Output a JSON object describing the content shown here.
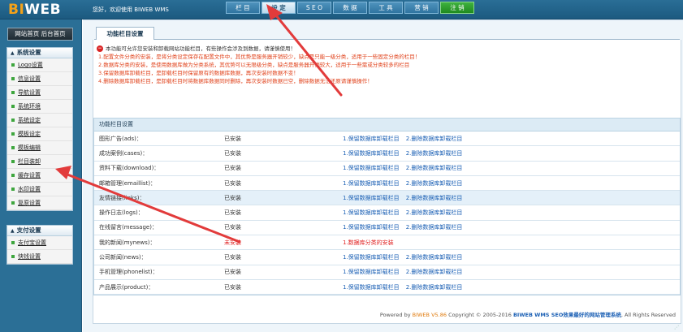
{
  "header": {
    "logo_bi": "BI",
    "logo_web": "WEB",
    "welcome": "您好，欢迎使用 BIWEB WMS",
    "nav": [
      {
        "label": "栏 目",
        "active": false
      },
      {
        "label": "设 定",
        "active": true
      },
      {
        "label": "S E O",
        "active": false
      },
      {
        "label": "数 据",
        "active": false
      },
      {
        "label": "工 具",
        "active": false
      },
      {
        "label": "营 销",
        "active": false
      },
      {
        "label": "注 销",
        "active": false
      }
    ]
  },
  "sidebar": {
    "home_button": "网站首页 后台首页",
    "system": {
      "title": "系统设置",
      "items": [
        "Logo设置",
        "信息设置",
        "导航设置",
        "系统环境",
        "系统设定",
        "模板设定",
        "模板编辑",
        "栏目装卸",
        "缓存设置",
        "水印设置",
        "复原设置"
      ]
    },
    "payment": {
      "title": "支付设置",
      "items": [
        "支付宝设置",
        "快钱设置"
      ]
    }
  },
  "main": {
    "tab": "功能栏目设置",
    "warnings": [
      "本功能可允许您安装和卸载网站功能栏目，有些操作会涉及到数据，请谨慎使用！",
      "1.配置文件分类的安装，是将分类设定保存在配置文件中，其优势是服务器开销较少，缺点是只能一级分类，适用于一些固定分类的栏目！",
      "2.数据库分类的安装，是使用数据库做为分类系统，其优势可以无限级分类，缺点是服务器开销较大，适用于一些需或分类较多的栏目",
      "3.保留数据库卸载栏目，是卸载栏目时保留原有的数据库数据，再次安装时数据不变！",
      "4.删除数据库卸载栏目，是卸载栏目时将数据库数据同时删除，再次安装时数据已空，删除数据无法还原请谨慎操作！"
    ],
    "table_header": "功能栏目设置",
    "rows": [
      {
        "name": "图形广告(ads)：",
        "status": "已安装",
        "action1": "1.保留数据库卸载栏目",
        "action2": "2.删除数据库卸载栏目"
      },
      {
        "name": "成功案例(cases)：",
        "status": "已安装",
        "action1": "1.保留数据库卸载栏目",
        "action2": "2.删除数据库卸载栏目"
      },
      {
        "name": "资料下载(download)：",
        "status": "已安装",
        "action1": "1.保留数据库卸载栏目",
        "action2": "2.删除数据库卸载栏目"
      },
      {
        "name": "邮箱管理(emaillist)：",
        "status": "已安装",
        "action1": "1.保留数据库卸载栏目",
        "action2": "2.删除数据库卸载栏目"
      },
      {
        "name": "友情链接(links)：",
        "status": "已安装",
        "action1": "1.保留数据库卸载栏目",
        "action2": "2.删除数据库卸载栏目"
      },
      {
        "name": "操作日志(logs)：",
        "status": "已安装",
        "action1": "1.保留数据库卸载栏目",
        "action2": "2.删除数据库卸载栏目"
      },
      {
        "name": "在线留言(message)：",
        "status": "已安装",
        "action1": "1.保留数据库卸载栏目",
        "action2": "2.删除数据库卸载栏目"
      },
      {
        "name": "我的新闻(mynews)：",
        "status": "未安装",
        "action1": "1.数据库分类的安装",
        "action2": ""
      },
      {
        "name": "公司新闻(news)：",
        "status": "已安装",
        "action1": "1.保留数据库卸载栏目",
        "action2": "2.删除数据库卸载栏目"
      },
      {
        "name": "手机管理(phonelist)：",
        "status": "已安装",
        "action1": "1.保留数据库卸载栏目",
        "action2": "2.删除数据库卸载栏目"
      },
      {
        "name": "产品展示(product)：",
        "status": "已安装",
        "action1": "1.保留数据库卸载栏目",
        "action2": "2.删除数据库卸载栏目"
      }
    ],
    "footer": {
      "powered": "Powered by ",
      "brand": "BIWEB V5.86",
      "copyright": " Copyright © 2005-2016 ",
      "product": "BIWEB WMS SEO效果最好的网站管理系统",
      "rights": ", All Rights Reserved"
    }
  },
  "colors": {
    "topbar": "#1f6288",
    "accent_orange": "#f3a21a",
    "warning_red": "#e0411a",
    "link_blue": "#1a5fb4",
    "arrow_red": "#e23b3b"
  }
}
